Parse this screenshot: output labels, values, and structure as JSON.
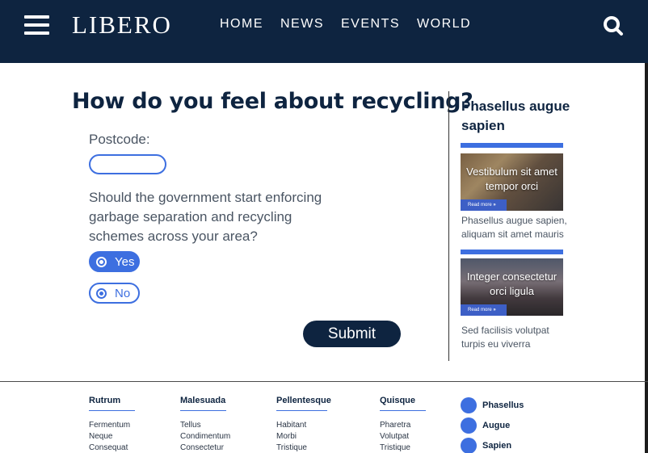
{
  "header": {
    "logo": "LIBERO",
    "nav": [
      "HOME",
      "NEWS",
      "EVENTS",
      "WORLD"
    ]
  },
  "survey": {
    "title": "How do you feel about recycling?",
    "postcode_label": "Postcode:",
    "postcode_value": "",
    "question": "Should the government start enforcing garbage separation and recycling schemes across your area?",
    "options": [
      "Yes",
      "No"
    ],
    "selected": "Yes",
    "submit_label": "Submit"
  },
  "sidebar": {
    "title": "Phasellus augue sapien",
    "cards": [
      {
        "caption": "Vestibulum sit amet tempor orci",
        "read_more": "Read more",
        "text": "Phasellus augue sapien, aliquam sit amet mauris"
      },
      {
        "caption": "Integer consectetur orci ligula",
        "read_more": "Read more",
        "text": "Sed facilisis volutpat turpis eu viverra"
      }
    ]
  },
  "footer": {
    "columns": [
      {
        "heading": "Rutrum",
        "links": [
          "Fermentum",
          "Neque",
          "Consequat"
        ]
      },
      {
        "heading": "Malesuada",
        "links": [
          "Tellus",
          "Condimentum",
          "Consectetur"
        ]
      },
      {
        "heading": "Pellentesque",
        "links": [
          "Habitant",
          "Morbi",
          "Tristique"
        ]
      },
      {
        "heading": "Quisque",
        "links": [
          "Pharetra",
          "Volutpat",
          "Tristique"
        ]
      }
    ],
    "social": [
      "Phasellus",
      "Augue",
      "Sapien"
    ]
  },
  "colors": {
    "navy": "#0e2440",
    "accent": "#3d6fe0"
  }
}
